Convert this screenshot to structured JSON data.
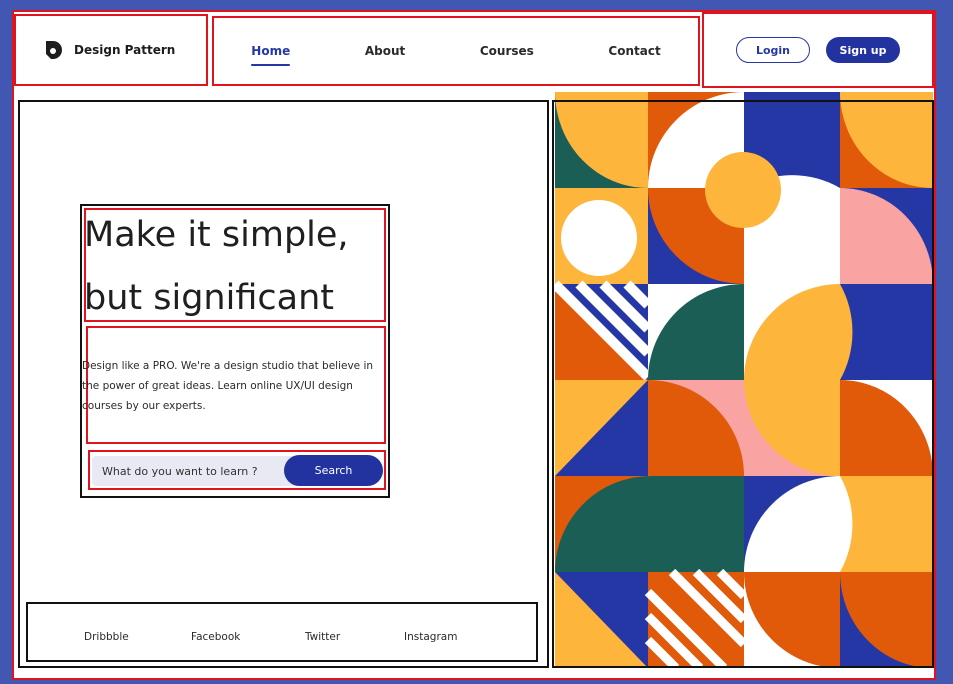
{
  "header": {
    "logo_text": "Design Pattern",
    "nav": [
      "Home",
      "About",
      "Courses",
      "Contact"
    ],
    "active_nav": "Home",
    "login_label": "Login",
    "signup_label": "Sign up"
  },
  "hero": {
    "title_line1": "Make it simple,",
    "title_line2": "but significant",
    "description": "Design like a PRO. We're a design studio that believe in the power of great ideas. Learn online UX/UI design courses by our experts.",
    "search_placeholder": "What do you want to learn ?",
    "search_button": "Search"
  },
  "social": [
    "Dribbble",
    "Facebook",
    "Twitter",
    "Instagram"
  ],
  "colors": {
    "primary": "#2233a0",
    "annotation_red": "#e0141e",
    "orange": "#e05a0a",
    "yellow": "#fdb53c",
    "green": "#1b5e55",
    "pink": "#f9a3a3",
    "blue": "#2537a4"
  }
}
